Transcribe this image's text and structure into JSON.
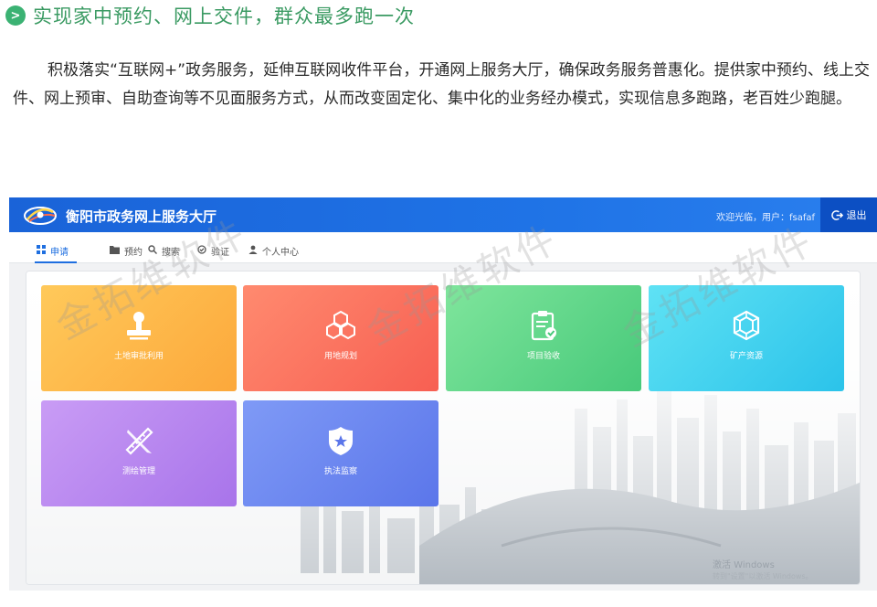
{
  "article": {
    "badge": ">",
    "heading": "实现家中预约、网上交件，群众最多跑一次",
    "paragraph": "积极落实“互联网+”政务服务，延伸互联网收件平台，开通网上服务大厅，确保政务服务普惠化。提供家中预约、线上交件、网上预审、自助查询等不见面服务方式，从而改变固定化、集中化的业务经办模式，实现信息多跑路，老百姓少跑腿。"
  },
  "app": {
    "title": "衡阳市政务网上服务大厅",
    "welcome": "欢迎光临，用户：fsafaf",
    "logout_label": "退出",
    "nav": [
      {
        "label": "申请",
        "icon": "grid-icon",
        "active": true
      },
      {
        "label": "预约",
        "icon": "folder-icon",
        "active": false
      },
      {
        "label": "搜索",
        "icon": "search-icon",
        "active": false
      },
      {
        "label": "验证",
        "icon": "check-circle-icon",
        "active": false
      },
      {
        "label": "个人中心",
        "icon": "user-icon",
        "active": false
      }
    ],
    "tiles": [
      {
        "label": "土地审批利用",
        "icon": "stamp-icon",
        "color": "#fcaf42"
      },
      {
        "label": "用地规划",
        "icon": "cubes-icon",
        "color": "#f96a58"
      },
      {
        "label": "项目验收",
        "icon": "clipboard-check-icon",
        "color": "#52cf82"
      },
      {
        "label": "矿产资源",
        "icon": "gem-icon",
        "color": "#35c9ec"
      },
      {
        "label": "测绘管理",
        "icon": "ruler-pencil-icon",
        "color": "#b07ded"
      },
      {
        "label": "执法监察",
        "icon": "police-badge-icon",
        "color": "#6480ee"
      }
    ],
    "windows_activate": {
      "line1": "激活 Windows",
      "line2": "转到\"设置\"以激活 Windows。"
    }
  },
  "watermark_text": "金拓维软件",
  "colors": {
    "heading": "#3a9a62",
    "topbar": "#1f73e6",
    "logout": "#0c4fc3",
    "nav_active": "#1f6fe0"
  }
}
